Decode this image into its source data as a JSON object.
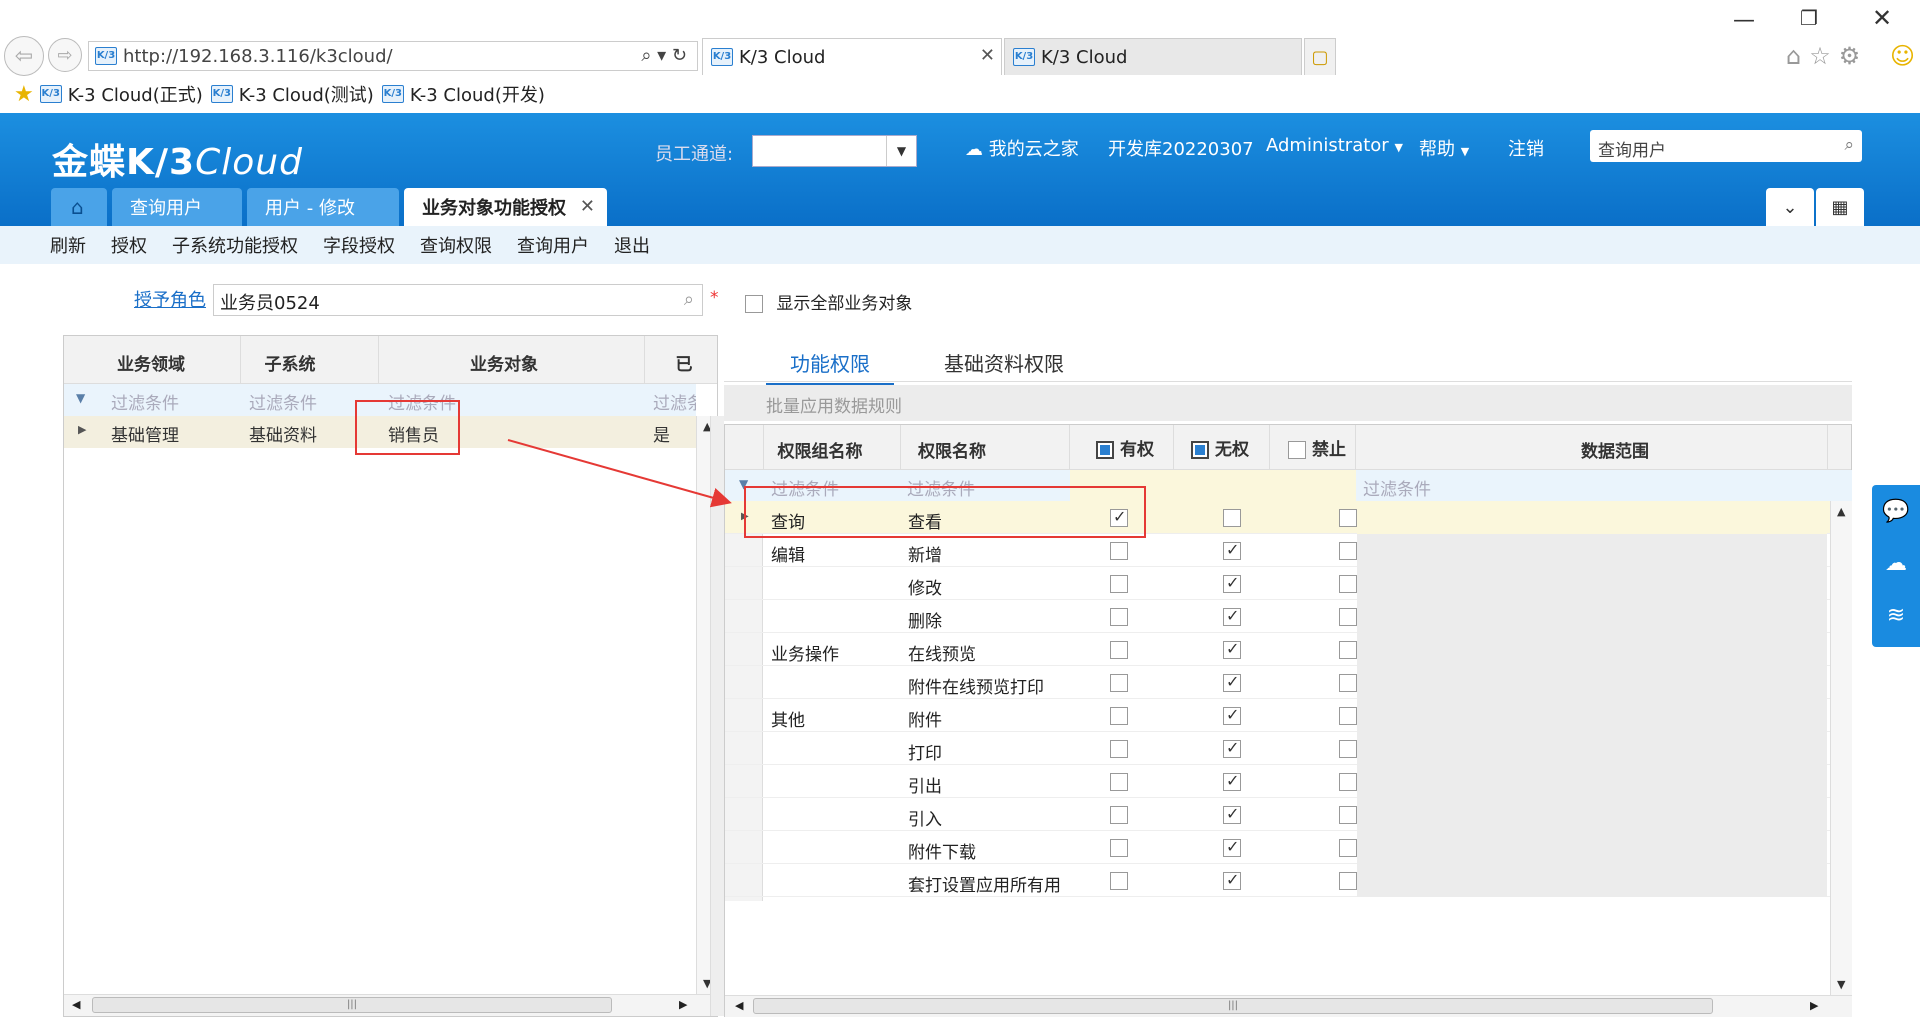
{
  "browser": {
    "url": "http://192.168.3.116/k3cloud/",
    "tabs": [
      {
        "label": "K/3 Cloud",
        "active": true
      },
      {
        "label": "K/3 Cloud",
        "active": false
      }
    ],
    "bookmarks": [
      "K-3 Cloud(正式)",
      "K-3 Cloud(测试)",
      "K-3 Cloud(开发)"
    ]
  },
  "header": {
    "brand_main": "金蝶K/3",
    "brand_cloud": "Cloud",
    "channel_label": "员工通道:",
    "channel_value": "",
    "my_cloud": "我的云之家",
    "database": "开发库20220307",
    "user": "Administrator",
    "help": "帮助",
    "logout": "注销",
    "search_value": "查询用户"
  },
  "app_tabs": [
    {
      "label": "查询用户"
    },
    {
      "label": "用户 - 修改"
    },
    {
      "label": "业务对象功能授权"
    }
  ],
  "toolbar": [
    "刷新",
    "授权",
    "子系统功能授权",
    "字段授权",
    "查询权限",
    "查询用户",
    "退出"
  ],
  "role": {
    "label": "授予角色",
    "value": "业务员0524",
    "show_all_label": "显示全部业务对象"
  },
  "left_grid": {
    "columns": [
      "业务领域",
      "子系统",
      "业务对象",
      "已"
    ],
    "filter_placeholder": "过滤条件",
    "rows": [
      {
        "domain": "基础管理",
        "subsystem": "基础资料",
        "object": "销售员",
        "flag": "是"
      }
    ]
  },
  "right_tabs": [
    "功能权限",
    "基础资料权限"
  ],
  "batch_label": "批量应用数据规则",
  "right_grid": {
    "columns": {
      "group": "权限组名称",
      "name": "权限名称",
      "has": "有权",
      "none": "无权",
      "deny": "禁止",
      "range": "数据范围"
    },
    "filter_placeholder": "过滤条件",
    "rows": [
      {
        "group": "查询",
        "name": "查看",
        "has": true,
        "none": false,
        "deny": false
      },
      {
        "group": "编辑",
        "name": "新增",
        "has": false,
        "none": true,
        "deny": false
      },
      {
        "group": "",
        "name": "修改",
        "has": false,
        "none": true,
        "deny": false
      },
      {
        "group": "",
        "name": "删除",
        "has": false,
        "none": true,
        "deny": false
      },
      {
        "group": "业务操作",
        "name": "在线预览",
        "has": false,
        "none": true,
        "deny": false
      },
      {
        "group": "",
        "name": "附件在线预览打印",
        "has": false,
        "none": true,
        "deny": false
      },
      {
        "group": "其他",
        "name": "附件",
        "has": false,
        "none": true,
        "deny": false
      },
      {
        "group": "",
        "name": "打印",
        "has": false,
        "none": true,
        "deny": false
      },
      {
        "group": "",
        "name": "引出",
        "has": false,
        "none": true,
        "deny": false
      },
      {
        "group": "",
        "name": "引入",
        "has": false,
        "none": true,
        "deny": false
      },
      {
        "group": "",
        "name": "附件下载",
        "has": false,
        "none": true,
        "deny": false
      },
      {
        "group": "",
        "name": "套打设置应用所有用",
        "has": false,
        "none": true,
        "deny": false
      }
    ]
  },
  "colors": {
    "brand_blue": "#0a6fc8",
    "annotation_red": "#e53935",
    "link_blue": "#1a6fc8"
  }
}
